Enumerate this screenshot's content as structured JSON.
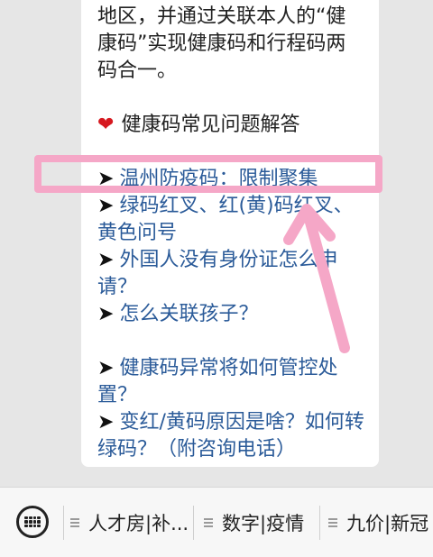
{
  "message": {
    "intro_lines": [
      "地区，并通过关联本人的“健",
      "康码”实现健康码和行程码两",
      "码合一。"
    ],
    "faq_heading": "健康码常见问题解答",
    "links": [
      "温州防疫码：限制聚集",
      "绿码红叉、红(黄)码红叉、",
      "黄色问号",
      "外国人没有身份证怎么申",
      "请？",
      "怎么关联孩子？",
      "健康码异常将如何管控处",
      "置？",
      "变红/黄码原因是啥？如何转",
      "绿码？（附咨询电话）"
    ],
    "arrow_glyph": "➤",
    "heart_glyph": "❤"
  },
  "tabbar": {
    "keyboard_icon": "keyboard-icon",
    "tabs": [
      {
        "label": "人才房|补..."
      },
      {
        "label": "数字|疫情"
      },
      {
        "label": "九价|新冠"
      }
    ]
  },
  "colors": {
    "highlight": "#f5a7c7",
    "link": "#2b5b99",
    "heart": "#d6181f"
  }
}
